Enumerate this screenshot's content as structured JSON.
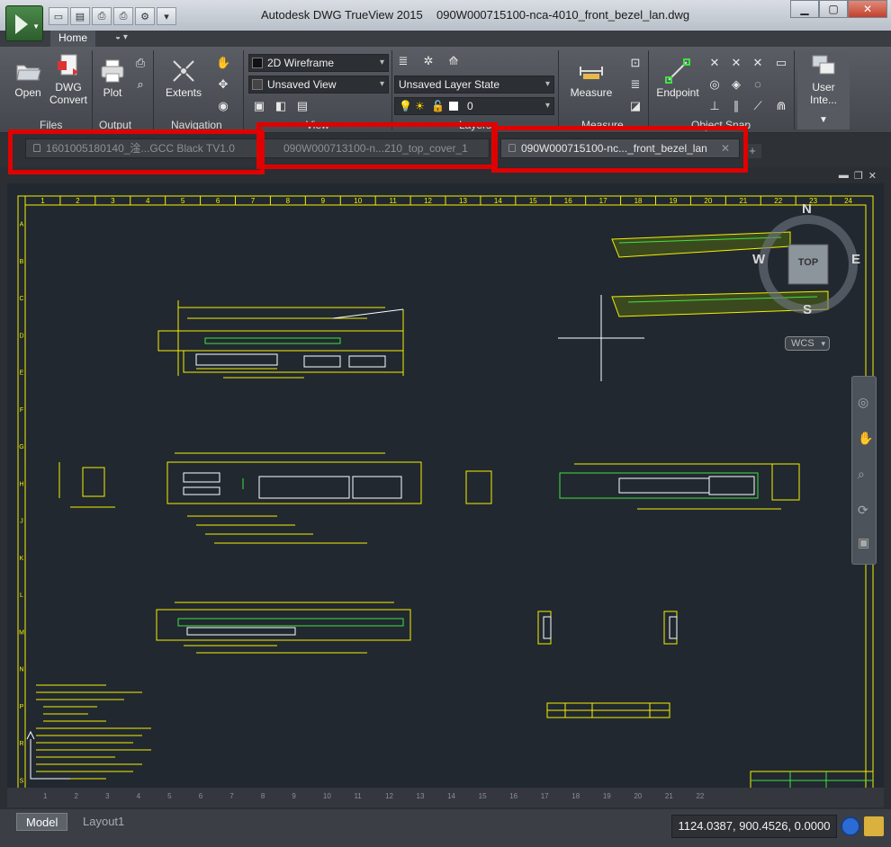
{
  "titlebar": {
    "app_name": "Autodesk DWG TrueView 2015",
    "file_name": "090W000715100-nca-4010_front_bezel_lan.dwg"
  },
  "ribbon": {
    "tab_home": "Home",
    "tools": {
      "open": "Open",
      "dwg_convert_1": "DWG",
      "dwg_convert_2": "Convert",
      "plot": "Plot",
      "extents": "Extents",
      "measure": "Measure",
      "endpoint": "Endpoint",
      "user_interface": "User Inte..."
    },
    "panels": {
      "files": "Files",
      "output": "Output",
      "navigation": "Navigation",
      "view": "View",
      "layers": "Layers",
      "measure": "Measure",
      "object_snap": "Object Snap"
    },
    "view_style": "2D Wireframe",
    "named_view": "Unsaved View",
    "layer_state": "Unsaved Layer State",
    "layer_name": "0"
  },
  "file_tabs": [
    {
      "label": "1601005180140_淦...GCC Black TV1.0",
      "active": false
    },
    {
      "label": "090W000713100-n...210_top_cover_1",
      "active": false
    },
    {
      "label": "090W000715100-nc..._front_bezel_lan",
      "active": true
    }
  ],
  "viewcube": {
    "north": "N",
    "south": "S",
    "east": "E",
    "west": "W",
    "face": "TOP",
    "ucs": "WCS"
  },
  "ruler_top": [
    "1",
    "2",
    "3",
    "4",
    "5",
    "6",
    "7",
    "8",
    "9",
    "10",
    "11",
    "12",
    "13",
    "14",
    "15",
    "16",
    "17",
    "18",
    "19",
    "20",
    "21",
    "22",
    "23",
    "24"
  ],
  "ruler_left": [
    "A",
    "B",
    "C",
    "D",
    "E",
    "F",
    "G",
    "H",
    "J",
    "K",
    "L",
    "M",
    "N",
    "P",
    "R",
    "S"
  ],
  "ruler_bottom": [
    "1",
    "2",
    "3",
    "4",
    "5",
    "6",
    "7",
    "8",
    "9",
    "10",
    "11",
    "12",
    "13",
    "14",
    "15",
    "16",
    "17",
    "18",
    "19",
    "20",
    "21",
    "22"
  ],
  "layout_tabs": {
    "model": "Model",
    "layout1": "Layout1"
  },
  "status": {
    "coordinates": "1124.0387, 900.4526, 0.0000"
  },
  "colors": {
    "drawing_bg": "#212830",
    "yellow": "#f5f000",
    "green": "#3fe23f",
    "white": "#ffffff",
    "red_highlight": "#e00000"
  }
}
